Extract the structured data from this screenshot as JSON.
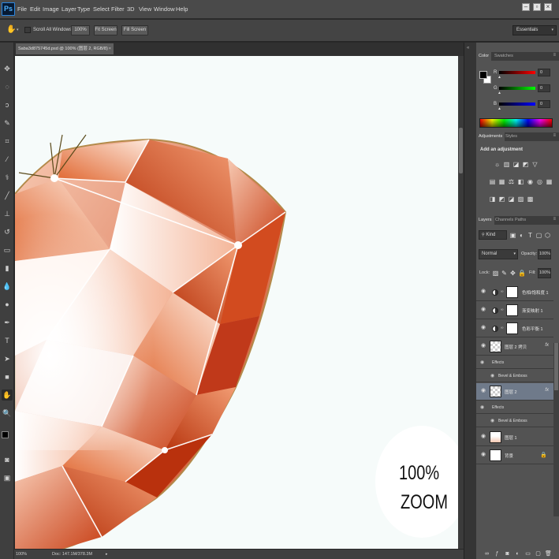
{
  "app": {
    "logo": "Ps",
    "menu": [
      "File",
      "Edit",
      "Image",
      "Layer",
      "Type",
      "Select",
      "Filter",
      "3D",
      "View",
      "Window",
      "Help"
    ],
    "window_controls": [
      "minimize-icon",
      "restore-icon",
      "close-icon"
    ]
  },
  "options_bar": {
    "tool_icon": "hand-tool-icon",
    "scroll_all_windows": "Scroll All Windows",
    "scroll_all_checked": false,
    "btn_100": "100%",
    "btn_fit": "Fit Screen",
    "btn_fill": "Fill Screen",
    "workspace": "Essentials"
  },
  "document": {
    "tab_title": "Saba3d875745d.psd @ 100% (图层 2, RGB/8)",
    "close": "×",
    "zoom_level": "100%",
    "doc_info": "Doc: 147.1M/378.3M"
  },
  "overlay": {
    "zoom_line1": "100%",
    "zoom_line2": "ZOOM"
  },
  "color_panel": {
    "tabs": [
      "Color",
      "Swatches"
    ],
    "channels": [
      {
        "label": "R",
        "value": "0",
        "color": "#e02020"
      },
      {
        "label": "G",
        "value": "0",
        "color": "#20c020"
      },
      {
        "label": "B",
        "value": "0",
        "color": "#2040e0"
      }
    ],
    "foreground": "#000000",
    "background": "#ffffff"
  },
  "adjustments_panel": {
    "tabs": [
      "Adjustments",
      "Styles"
    ],
    "heading": "Add an adjustment",
    "row1": [
      "brightness-icon",
      "levels-icon",
      "curves-icon",
      "exposure-icon",
      "gradient-triangle-icon"
    ],
    "row2": [
      "vibrance-icon",
      "hue-saturation-icon",
      "color-balance-icon",
      "black-white-icon",
      "photo-filter-icon",
      "channel-mixer-icon",
      "color-lookup-icon"
    ],
    "row3": [
      "invert-icon",
      "posterize-icon",
      "threshold-icon",
      "selective-color-icon",
      "gradient-map-icon"
    ]
  },
  "layers_panel": {
    "tabs": [
      "Layers",
      "Channels",
      "Paths"
    ],
    "filter_kind": "Kind",
    "blend_mode": "Normal",
    "opacity_label": "Opacity:",
    "opacity_value": "100%",
    "lock_label": "Lock:",
    "fill_label": "Fill:",
    "fill_value": "100%",
    "layers": [
      {
        "name": "色相/饱和度 1",
        "type": "adjustment"
      },
      {
        "name": "渐变映射 1",
        "type": "adjustment"
      },
      {
        "name": "色彩平衡 1",
        "type": "adjustment"
      },
      {
        "name": "图层 2 拷贝",
        "type": "pixel",
        "fx": "fx"
      },
      {
        "name": "图层 2",
        "type": "pixel",
        "fx": "fx",
        "selected": true
      },
      {
        "name": "图层 1",
        "type": "pixel"
      },
      {
        "name": "背景",
        "type": "background",
        "locked": true
      }
    ],
    "effects_label": "Effects",
    "bevel_label": "Bevel & Emboss"
  }
}
